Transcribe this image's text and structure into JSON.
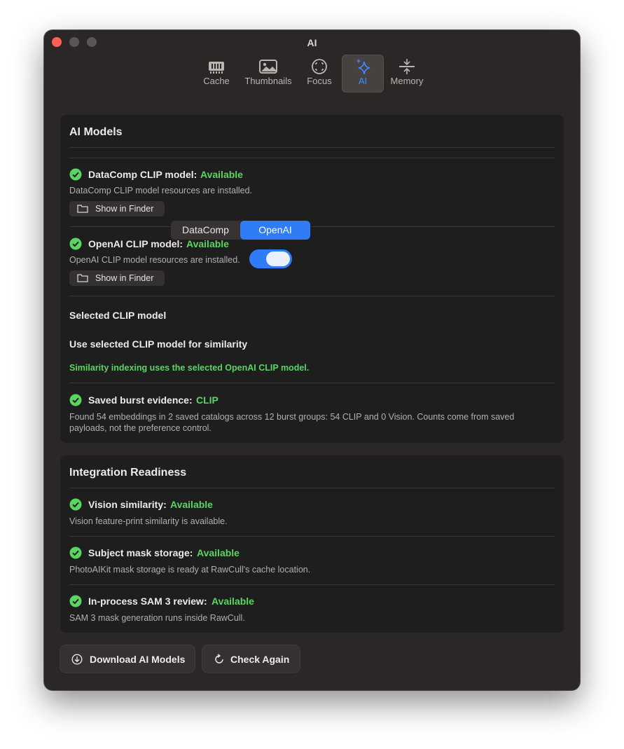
{
  "window": {
    "title": "AI"
  },
  "tabs": [
    {
      "label": "Cache",
      "icon": "memory-chip-icon"
    },
    {
      "label": "Thumbnails",
      "icon": "photo-icon"
    },
    {
      "label": "Focus",
      "icon": "focus-viewfinder-icon"
    },
    {
      "label": "AI",
      "icon": "sparkles-icon",
      "active": true
    },
    {
      "label": "Memory",
      "icon": "compress-arrows-icon"
    }
  ],
  "ai_models": {
    "title": "AI Models",
    "datacomp": {
      "label": "DataComp CLIP model:",
      "status": "Available",
      "description": "DataComp CLIP model resources are installed.",
      "button": "Show in Finder"
    },
    "openai": {
      "label": "OpenAI CLIP model:",
      "status": "Available",
      "description": "OpenAI CLIP model resources are installed.",
      "button": "Show in Finder"
    },
    "selected_model": {
      "label": "Selected CLIP model",
      "options": [
        "DataComp",
        "OpenAI"
      ],
      "selected": "OpenAI"
    },
    "similarity_toggle": {
      "label": "Use selected CLIP model for similarity",
      "on": true
    },
    "similarity_note": "Similarity indexing uses the selected OpenAI CLIP model.",
    "burst": {
      "label": "Saved burst evidence:",
      "status": "CLIP",
      "description": "Found 54 embeddings in 2 saved catalogs across 12 burst groups: 54 CLIP and 0 Vision. Counts come from saved payloads, not the preference control."
    }
  },
  "integration": {
    "title": "Integration Readiness",
    "items": [
      {
        "label": "Vision similarity:",
        "status": "Available",
        "description": "Vision feature-print similarity is available."
      },
      {
        "label": "Subject mask storage:",
        "status": "Available",
        "description": "PhotoAIKit mask storage is ready at RawCull's cache location."
      },
      {
        "label": "In-process SAM 3 review:",
        "status": "Available",
        "description": "SAM 3 mask generation runs inside RawCull."
      }
    ]
  },
  "footer": {
    "download_label": "Download AI Models",
    "check_label": "Check Again"
  },
  "colors": {
    "accent": "#2f7cf6",
    "available": "#5ad562",
    "close": "#fe5f57"
  }
}
